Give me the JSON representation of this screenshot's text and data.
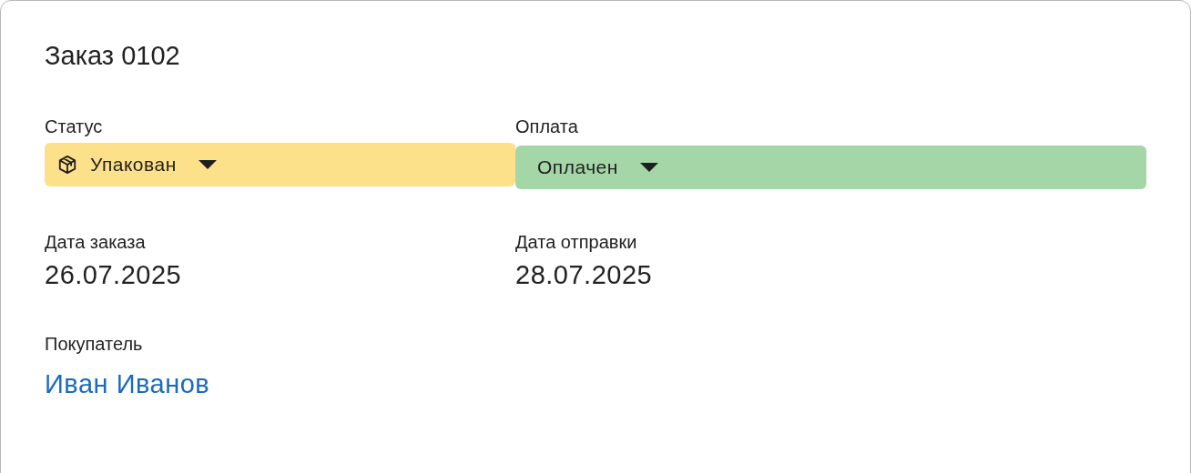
{
  "title": "Заказ 0102",
  "fields": [
    {
      "label": "Статус",
      "kind": "status",
      "value": "Упакован",
      "color": "#fde08a"
    },
    {
      "label": "Оплата",
      "kind": "payment",
      "value": "Оплачен",
      "color": "#a5d6a7"
    },
    {
      "label": "Дата заказа",
      "kind": "date",
      "value": "26.07.2025"
    },
    {
      "label": "Дата отправки",
      "kind": "date",
      "value": "28.07.2025"
    },
    {
      "label": "Покупатель",
      "kind": "link",
      "value": "Иван Иванов"
    }
  ]
}
